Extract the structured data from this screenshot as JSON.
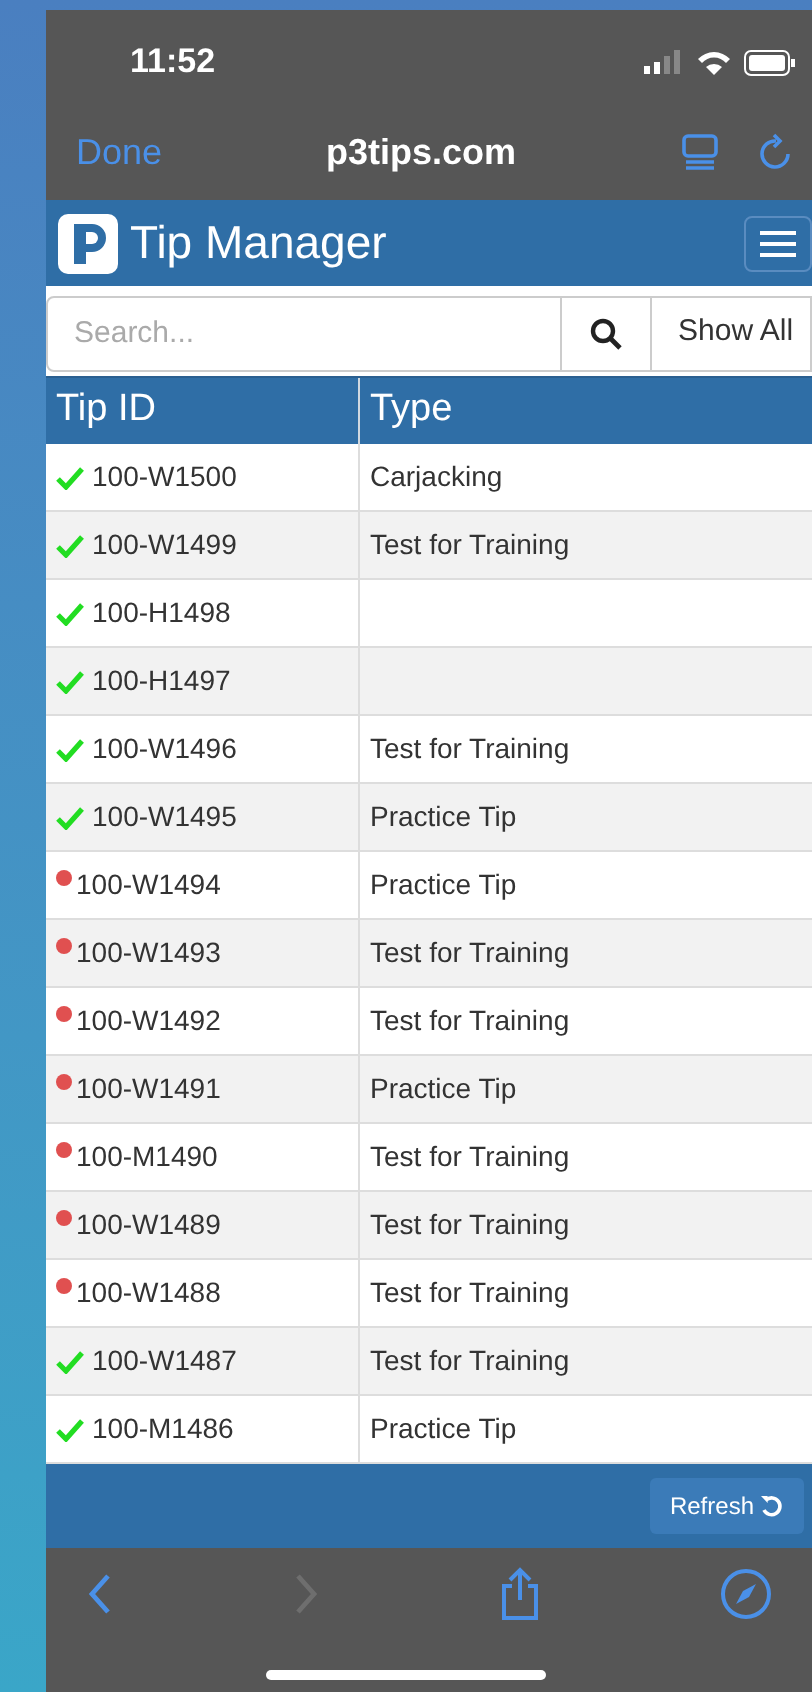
{
  "status_bar": {
    "time": "11:52"
  },
  "browser": {
    "done": "Done",
    "url": "p3tips.com"
  },
  "header": {
    "title": "Tip Manager"
  },
  "search": {
    "placeholder": "Search...",
    "show_all": "Show All"
  },
  "table": {
    "columns": [
      "Tip ID",
      "Type"
    ],
    "rows": [
      {
        "kind": "check",
        "id": "100-W1500",
        "type": "Carjacking"
      },
      {
        "kind": "check",
        "id": "100-W1499",
        "type": "Test for Training"
      },
      {
        "kind": "check",
        "id": "100-H1498"
      },
      {
        "kind": "check",
        "id": "100-H1497"
      },
      {
        "kind": "check",
        "id": "100-W1496",
        "type": "Test for Training"
      },
      {
        "kind": "check",
        "id": "100-W1495",
        "type": "Practice Tip"
      },
      {
        "kind": "dot",
        "id": "100-W1494",
        "type": "Practice Tip"
      },
      {
        "kind": "dot",
        "id": "100-W1493",
        "type": "Test for Training"
      },
      {
        "kind": "dot",
        "id": "100-W1492",
        "type": "Test for Training"
      },
      {
        "kind": "dot",
        "id": "100-W1491",
        "type": "Practice Tip"
      },
      {
        "kind": "dot",
        "id": "100-M1490",
        "type": "Test for Training"
      },
      {
        "kind": "dot",
        "id": "100-W1489",
        "type": "Test for Training"
      },
      {
        "kind": "dot",
        "id": "100-W1488",
        "type": "Test for Training"
      },
      {
        "kind": "check",
        "id": "100-W1487",
        "type": "Test for Training"
      },
      {
        "kind": "check",
        "id": "100-M1486",
        "type": "Practice Tip"
      }
    ]
  },
  "footer": {
    "refresh": "Refresh"
  }
}
